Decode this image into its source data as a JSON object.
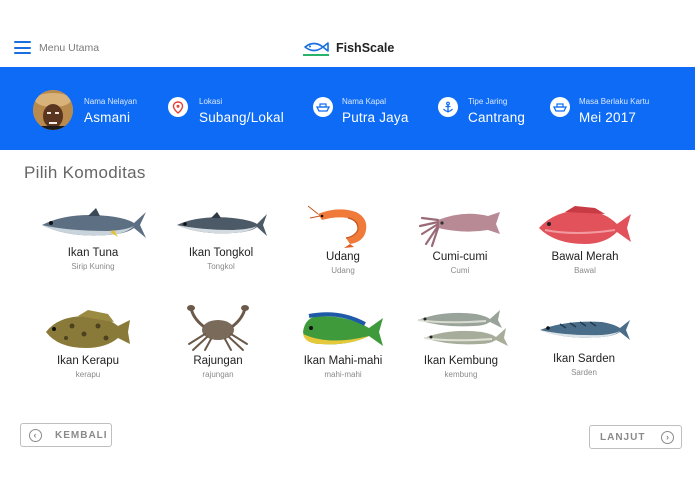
{
  "header": {
    "menu_label": "Menu Utama",
    "brand_name": "FishScale"
  },
  "profile": {
    "fisher_label": "Nama Nelayan",
    "fisher_name": "Asmani",
    "location_label": "Lokasi",
    "location_value": "Subang/Lokal",
    "ship_label": "Nama Kapal",
    "ship_value": "Putra Jaya",
    "net_label": "Tipe Jaring",
    "net_value": "Cantrang",
    "card_label": "Masa Berlaku Kartu",
    "card_value": "Mei 2017"
  },
  "section": {
    "title": "Pilih Komoditas"
  },
  "commodities": [
    {
      "name": "Ikan Tuna",
      "sub": "Sirip Kuning",
      "icon": "tuna-icon"
    },
    {
      "name": "Ikan Tongkol",
      "sub": "Tongkol",
      "icon": "tongkol-icon"
    },
    {
      "name": "Udang",
      "sub": "Udang",
      "icon": "shrimp-icon"
    },
    {
      "name": "Cumi-cumi",
      "sub": "Cumi",
      "icon": "squid-icon"
    },
    {
      "name": "Bawal Merah",
      "sub": "Bawal",
      "icon": "red-snapper-icon"
    },
    {
      "name": "Ikan Kerapu",
      "sub": "kerapu",
      "icon": "grouper-icon"
    },
    {
      "name": "Rajungan",
      "sub": "rajungan",
      "icon": "crab-icon"
    },
    {
      "name": "Ikan Mahi-mahi",
      "sub": "mahi-mahi",
      "icon": "mahi-mahi-icon"
    },
    {
      "name": "Ikan Kembung",
      "sub": "kembung",
      "icon": "mackerel-icon"
    },
    {
      "name": "Ikan Sarden",
      "sub": "Sarden",
      "icon": "sardine-icon"
    }
  ],
  "nav": {
    "back_label": "KEMBALI",
    "next_label": "LANJUT"
  },
  "colors": {
    "accent": "#0d6bf5",
    "menu_icon": "#1a6fe0"
  }
}
